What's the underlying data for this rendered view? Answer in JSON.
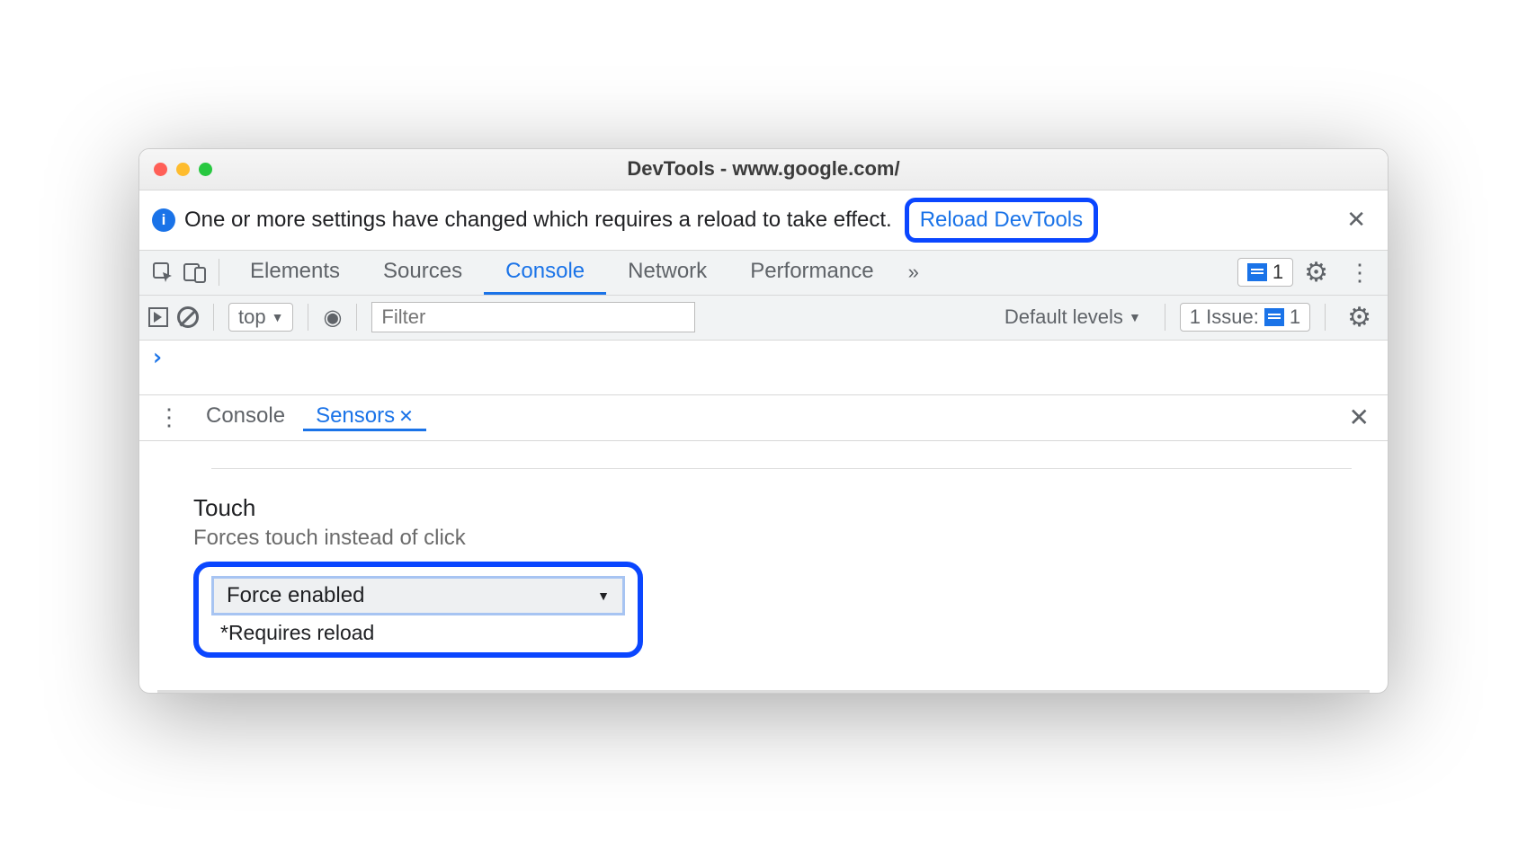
{
  "window": {
    "title": "DevTools - www.google.com/"
  },
  "infobar": {
    "message": "One or more settings have changed which requires a reload to take effect.",
    "button": "Reload DevTools"
  },
  "tabs": {
    "items": [
      "Elements",
      "Sources",
      "Console",
      "Network",
      "Performance"
    ],
    "active_index": 2,
    "badge_count": "1"
  },
  "console_toolbar": {
    "context": "top",
    "filter_placeholder": "Filter",
    "levels": "Default levels",
    "issues_label": "1 Issue:",
    "issues_count": "1"
  },
  "console_body": {
    "prompt": "›"
  },
  "drawer": {
    "tabs": [
      "Console",
      "Sensors"
    ],
    "active_index": 1
  },
  "sensors": {
    "field_label": "Touch",
    "field_desc": "Forces touch instead of click",
    "select_value": "Force enabled",
    "reload_note": "*Requires reload"
  }
}
